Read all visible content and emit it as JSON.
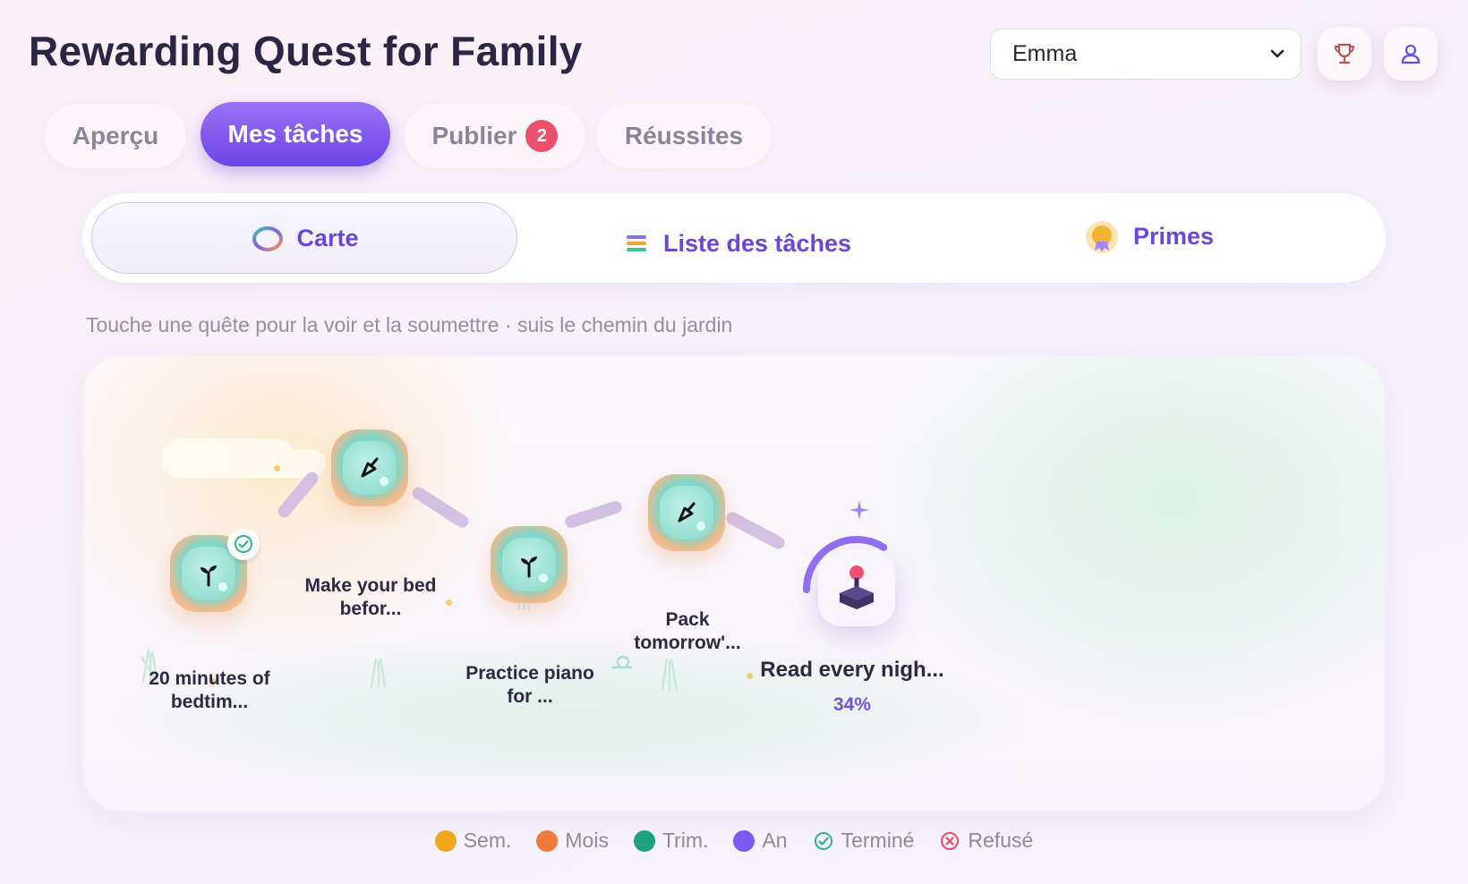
{
  "app": {
    "title": "Rewarding Quest for Family"
  },
  "header": {
    "selected_user": "Emma",
    "trophy_icon": "trophy-icon",
    "profile_icon": "user-icon"
  },
  "tabs": [
    {
      "label": "Aperçu",
      "active": false
    },
    {
      "label": "Mes tâches",
      "active": true
    },
    {
      "label": "Publier",
      "active": false,
      "badge": "2"
    },
    {
      "label": "Réussites",
      "active": false
    }
  ],
  "subnav": [
    {
      "label": "Carte",
      "icon": "ring-icon",
      "active": true
    },
    {
      "label": "Liste des tâches",
      "icon": "list-icon",
      "active": false
    },
    {
      "label": "Primes",
      "icon": "medal-icon",
      "active": false
    }
  ],
  "hint": "Touche une quête pour la voir et la soumettre · suis le chemin du jardin",
  "quests": [
    {
      "label": "20 minutes of bedtim...",
      "icon": "sprout-icon",
      "completed": true
    },
    {
      "label": "Make your bed befor...",
      "icon": "brush-icon",
      "completed": false
    },
    {
      "label": "Practice piano for ...",
      "icon": "sprout-icon",
      "completed": false
    },
    {
      "label": "Pack tomorrow'...",
      "icon": "brush-icon",
      "completed": false
    }
  ],
  "goal": {
    "label": "Read every nigh...",
    "progress_text": "34%",
    "progress": 0.34,
    "icon": "joystick-icon"
  },
  "legend": [
    {
      "label": "Sem.",
      "color": "#f2a71b",
      "kind": "dot"
    },
    {
      "label": "Mois",
      "color": "#f07a3a",
      "kind": "dot"
    },
    {
      "label": "Trim.",
      "color": "#1fa37f",
      "kind": "dot"
    },
    {
      "label": "An",
      "color": "#7a5af0",
      "kind": "dot"
    },
    {
      "label": "Terminé",
      "color": "#2fb38a",
      "kind": "check"
    },
    {
      "label": "Refusé",
      "color": "#e84b5f",
      "kind": "cross"
    }
  ]
}
